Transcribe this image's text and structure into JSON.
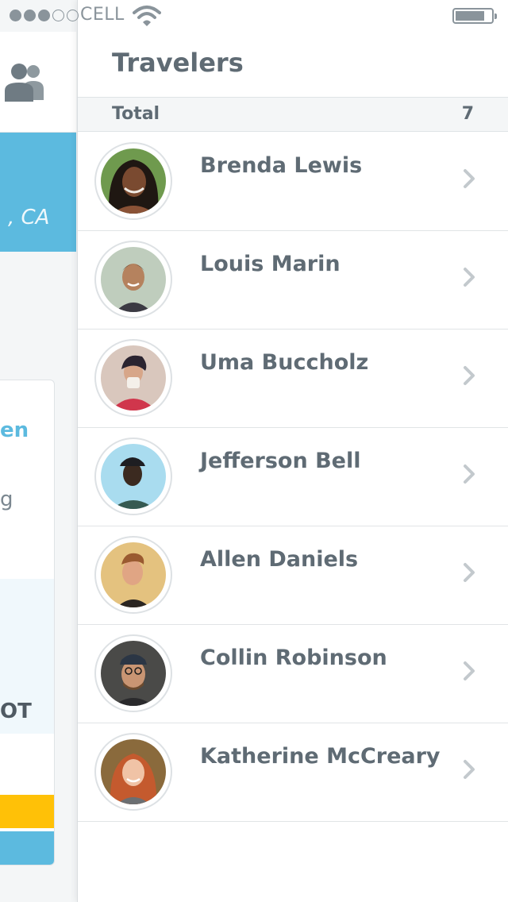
{
  "status_bar": {
    "carrier": "CELL",
    "signal_strength": "3 of 5"
  },
  "background": {
    "location_fragment": ", CA",
    "card_name_fragment": "en",
    "card_line_fragment": "g",
    "card_code_fragment": "OT"
  },
  "travelers": {
    "title": "Travelers",
    "total_label": "Total",
    "total_count": "7",
    "items": [
      {
        "name": "Brenda Lewis"
      },
      {
        "name": "Louis Marin"
      },
      {
        "name": "Uma Buccholz"
      },
      {
        "name": "Jefferson Bell"
      },
      {
        "name": "Allen Daniels"
      },
      {
        "name": "Collin Robinson"
      },
      {
        "name": "Katherine McCreary"
      }
    ]
  },
  "colors": {
    "accent_blue": "#5cbadf",
    "accent_yellow": "#ffc107",
    "text_gray": "#5f6b74",
    "chevron_gray": "#c3c9cd"
  },
  "icons": {
    "row_chevron": "chevron-right-icon",
    "header_people": "people-icon"
  }
}
